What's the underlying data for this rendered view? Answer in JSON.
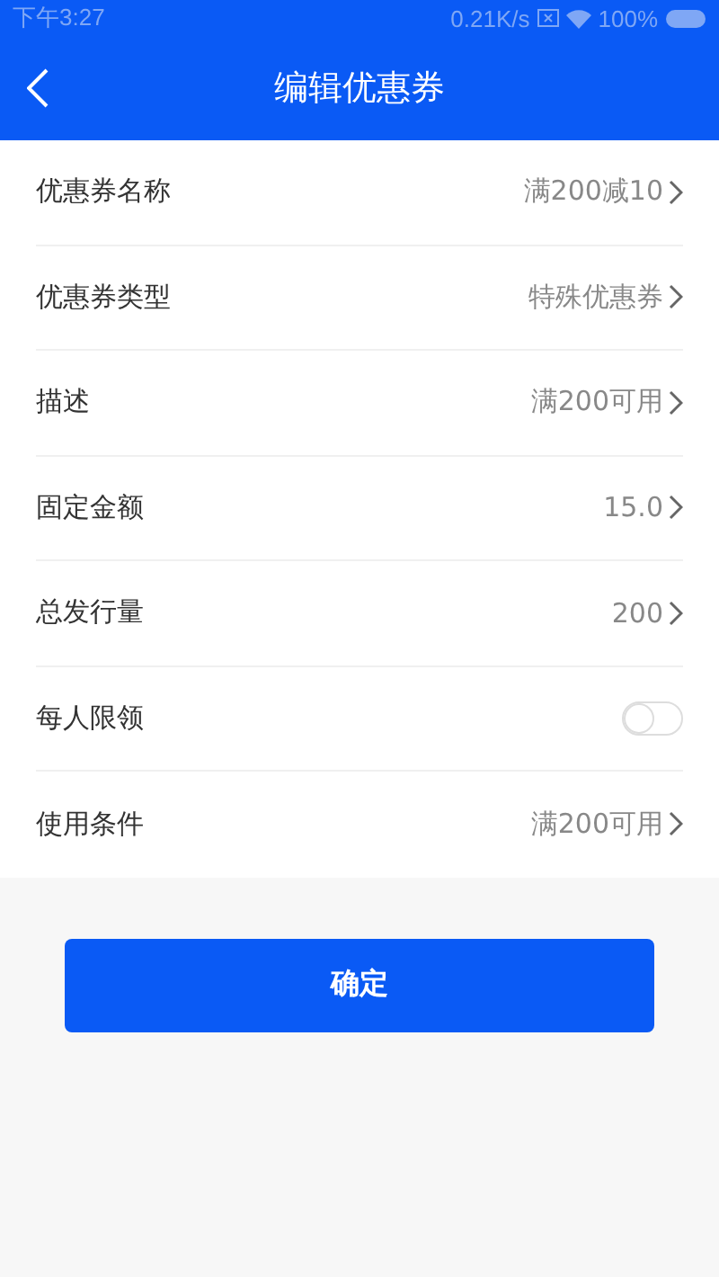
{
  "status_bar": {
    "time": "下午3:27",
    "speed": "0.21K/s",
    "battery": "100%"
  },
  "header": {
    "title": "编辑优惠券"
  },
  "rows": [
    {
      "kind": "value",
      "label": "优惠券名称",
      "value": "满200减10"
    },
    {
      "kind": "value",
      "label": "优惠券类型",
      "value": "特殊优惠券"
    },
    {
      "kind": "value",
      "label": "描述",
      "value": "满200可用"
    },
    {
      "kind": "value",
      "label": "固定金额",
      "value": "15.0"
    },
    {
      "kind": "value",
      "label": "总发行量",
      "value": "200"
    },
    {
      "kind": "toggle",
      "label": "每人限领",
      "on": false
    },
    {
      "kind": "value",
      "label": "使用条件",
      "value": "满200可用"
    }
  ],
  "confirm_button": "确定"
}
